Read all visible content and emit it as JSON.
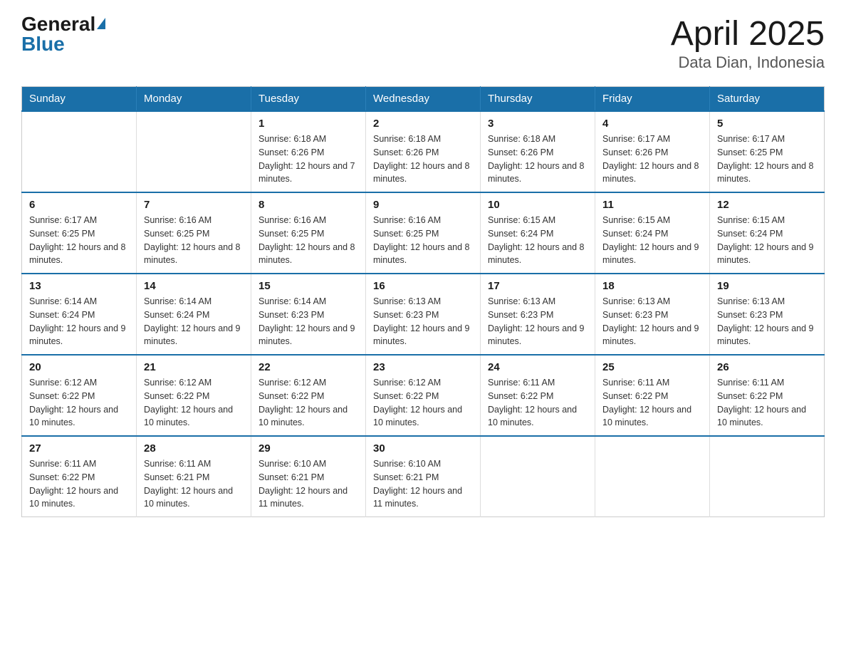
{
  "header": {
    "logo_general": "General",
    "logo_blue": "Blue",
    "title": "April 2025",
    "subtitle": "Data Dian, Indonesia"
  },
  "weekdays": [
    "Sunday",
    "Monday",
    "Tuesday",
    "Wednesday",
    "Thursday",
    "Friday",
    "Saturday"
  ],
  "weeks": [
    [
      {
        "day": "",
        "sunrise": "",
        "sunset": "",
        "daylight": ""
      },
      {
        "day": "",
        "sunrise": "",
        "sunset": "",
        "daylight": ""
      },
      {
        "day": "1",
        "sunrise": "Sunrise: 6:18 AM",
        "sunset": "Sunset: 6:26 PM",
        "daylight": "Daylight: 12 hours and 7 minutes."
      },
      {
        "day": "2",
        "sunrise": "Sunrise: 6:18 AM",
        "sunset": "Sunset: 6:26 PM",
        "daylight": "Daylight: 12 hours and 8 minutes."
      },
      {
        "day": "3",
        "sunrise": "Sunrise: 6:18 AM",
        "sunset": "Sunset: 6:26 PM",
        "daylight": "Daylight: 12 hours and 8 minutes."
      },
      {
        "day": "4",
        "sunrise": "Sunrise: 6:17 AM",
        "sunset": "Sunset: 6:26 PM",
        "daylight": "Daylight: 12 hours and 8 minutes."
      },
      {
        "day": "5",
        "sunrise": "Sunrise: 6:17 AM",
        "sunset": "Sunset: 6:25 PM",
        "daylight": "Daylight: 12 hours and 8 minutes."
      }
    ],
    [
      {
        "day": "6",
        "sunrise": "Sunrise: 6:17 AM",
        "sunset": "Sunset: 6:25 PM",
        "daylight": "Daylight: 12 hours and 8 minutes."
      },
      {
        "day": "7",
        "sunrise": "Sunrise: 6:16 AM",
        "sunset": "Sunset: 6:25 PM",
        "daylight": "Daylight: 12 hours and 8 minutes."
      },
      {
        "day": "8",
        "sunrise": "Sunrise: 6:16 AM",
        "sunset": "Sunset: 6:25 PM",
        "daylight": "Daylight: 12 hours and 8 minutes."
      },
      {
        "day": "9",
        "sunrise": "Sunrise: 6:16 AM",
        "sunset": "Sunset: 6:25 PM",
        "daylight": "Daylight: 12 hours and 8 minutes."
      },
      {
        "day": "10",
        "sunrise": "Sunrise: 6:15 AM",
        "sunset": "Sunset: 6:24 PM",
        "daylight": "Daylight: 12 hours and 8 minutes."
      },
      {
        "day": "11",
        "sunrise": "Sunrise: 6:15 AM",
        "sunset": "Sunset: 6:24 PM",
        "daylight": "Daylight: 12 hours and 9 minutes."
      },
      {
        "day": "12",
        "sunrise": "Sunrise: 6:15 AM",
        "sunset": "Sunset: 6:24 PM",
        "daylight": "Daylight: 12 hours and 9 minutes."
      }
    ],
    [
      {
        "day": "13",
        "sunrise": "Sunrise: 6:14 AM",
        "sunset": "Sunset: 6:24 PM",
        "daylight": "Daylight: 12 hours and 9 minutes."
      },
      {
        "day": "14",
        "sunrise": "Sunrise: 6:14 AM",
        "sunset": "Sunset: 6:24 PM",
        "daylight": "Daylight: 12 hours and 9 minutes."
      },
      {
        "day": "15",
        "sunrise": "Sunrise: 6:14 AM",
        "sunset": "Sunset: 6:23 PM",
        "daylight": "Daylight: 12 hours and 9 minutes."
      },
      {
        "day": "16",
        "sunrise": "Sunrise: 6:13 AM",
        "sunset": "Sunset: 6:23 PM",
        "daylight": "Daylight: 12 hours and 9 minutes."
      },
      {
        "day": "17",
        "sunrise": "Sunrise: 6:13 AM",
        "sunset": "Sunset: 6:23 PM",
        "daylight": "Daylight: 12 hours and 9 minutes."
      },
      {
        "day": "18",
        "sunrise": "Sunrise: 6:13 AM",
        "sunset": "Sunset: 6:23 PM",
        "daylight": "Daylight: 12 hours and 9 minutes."
      },
      {
        "day": "19",
        "sunrise": "Sunrise: 6:13 AM",
        "sunset": "Sunset: 6:23 PM",
        "daylight": "Daylight: 12 hours and 9 minutes."
      }
    ],
    [
      {
        "day": "20",
        "sunrise": "Sunrise: 6:12 AM",
        "sunset": "Sunset: 6:22 PM",
        "daylight": "Daylight: 12 hours and 10 minutes."
      },
      {
        "day": "21",
        "sunrise": "Sunrise: 6:12 AM",
        "sunset": "Sunset: 6:22 PM",
        "daylight": "Daylight: 12 hours and 10 minutes."
      },
      {
        "day": "22",
        "sunrise": "Sunrise: 6:12 AM",
        "sunset": "Sunset: 6:22 PM",
        "daylight": "Daylight: 12 hours and 10 minutes."
      },
      {
        "day": "23",
        "sunrise": "Sunrise: 6:12 AM",
        "sunset": "Sunset: 6:22 PM",
        "daylight": "Daylight: 12 hours and 10 minutes."
      },
      {
        "day": "24",
        "sunrise": "Sunrise: 6:11 AM",
        "sunset": "Sunset: 6:22 PM",
        "daylight": "Daylight: 12 hours and 10 minutes."
      },
      {
        "day": "25",
        "sunrise": "Sunrise: 6:11 AM",
        "sunset": "Sunset: 6:22 PM",
        "daylight": "Daylight: 12 hours and 10 minutes."
      },
      {
        "day": "26",
        "sunrise": "Sunrise: 6:11 AM",
        "sunset": "Sunset: 6:22 PM",
        "daylight": "Daylight: 12 hours and 10 minutes."
      }
    ],
    [
      {
        "day": "27",
        "sunrise": "Sunrise: 6:11 AM",
        "sunset": "Sunset: 6:22 PM",
        "daylight": "Daylight: 12 hours and 10 minutes."
      },
      {
        "day": "28",
        "sunrise": "Sunrise: 6:11 AM",
        "sunset": "Sunset: 6:21 PM",
        "daylight": "Daylight: 12 hours and 10 minutes."
      },
      {
        "day": "29",
        "sunrise": "Sunrise: 6:10 AM",
        "sunset": "Sunset: 6:21 PM",
        "daylight": "Daylight: 12 hours and 11 minutes."
      },
      {
        "day": "30",
        "sunrise": "Sunrise: 6:10 AM",
        "sunset": "Sunset: 6:21 PM",
        "daylight": "Daylight: 12 hours and 11 minutes."
      },
      {
        "day": "",
        "sunrise": "",
        "sunset": "",
        "daylight": ""
      },
      {
        "day": "",
        "sunrise": "",
        "sunset": "",
        "daylight": ""
      },
      {
        "day": "",
        "sunrise": "",
        "sunset": "",
        "daylight": ""
      }
    ]
  ]
}
